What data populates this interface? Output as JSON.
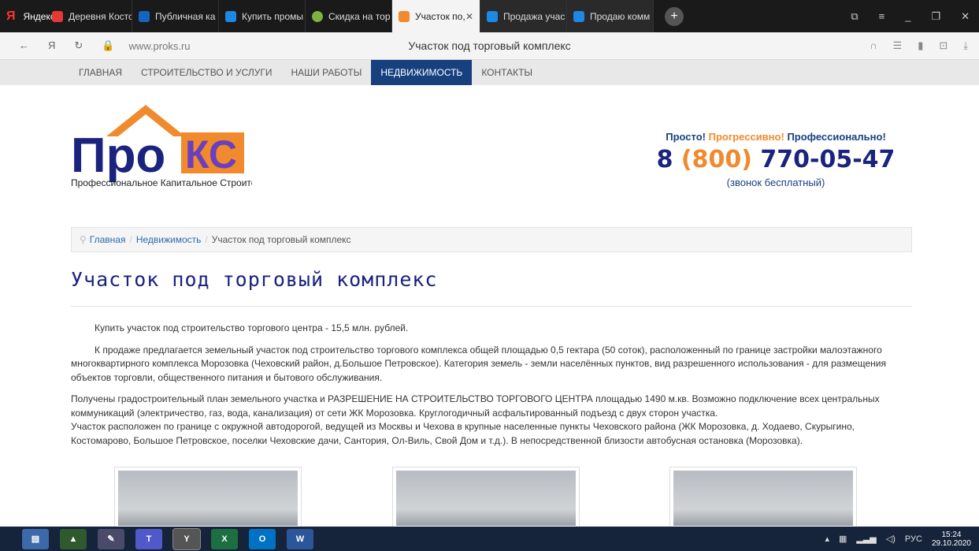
{
  "browser": {
    "yandex_label": "Яндекс",
    "tabs": [
      {
        "label": "Деревня Костс",
        "color": "#e53935"
      },
      {
        "label": "Публичная ка",
        "color": "#1565c0"
      },
      {
        "label": "Купить промы",
        "color": "#1e88e5"
      },
      {
        "label": "Скидка на тор",
        "color": "#7cb342"
      },
      {
        "label": "Участок по,",
        "color": "#f08a2c"
      },
      {
        "label": "Продажа учас",
        "color": "#1e88e5"
      },
      {
        "label": "Продаю комм",
        "color": "#1e88e5"
      }
    ],
    "url": "www.proks.ru",
    "page_title": "Участок под торговый комплекс"
  },
  "menu": [
    "ГЛАВНАЯ",
    "СТРОИТЕЛЬСТВО И УСЛУГИ",
    "НАШИ РАБОТЫ",
    "НЕДВИЖИМОСТЬ",
    "КОНТАКТЫ"
  ],
  "logo": {
    "word1": "Про",
    "word2": "КС",
    "sub": "Профессиональное Капитальное Строительство"
  },
  "contact": {
    "s1": "Просто!",
    "s2": "Прогрессивно!",
    "s3": "Профессионально!",
    "phone_a": "8 ",
    "phone_b": "(800)",
    "phone_c": " 770-05-47",
    "free": "(звонок бесплатный)"
  },
  "breadcrumb": {
    "home": "Главная",
    "sec": "Недвижимость",
    "cur": "Участок под торговый комплекс"
  },
  "heading": "Участок под торговый комплекс",
  "p1": "Купить участок под строительство торгового центра - 15,5 млн. рублей.",
  "p2": "К продаже предлагается земельный участок под строительство торгового комплекса общей площадью 0,5 гектара (50 соток), расположенный по границе застройки малоэтажного многоквартирного комплекса Морозовка (Чеховский район, д.Большое Петровское). Категория земель - земли населённых пунктов, вид разрешенного использования - для размещения объектов торговли, общественного питания и бытового обслуживания.",
  "p3": "Получены градостроительный план земельного участка и РАЗРЕШЕНИЕ НА СТРОИТЕЛЬСТВО ТОРГОВОГО ЦЕНТРА площадью 1490 м.кв. Возможно подключение всех центральных коммуникаций (электричество, газ, вода, канализация) от сети ЖК Морозовка. Круглогодичный асфальтированный подъезд с двух сторон участка.",
  "p4": "Участок расположен по границе с окружной автодорогой, ведущей из Москвы и Чехова в крупные населенные пункты Чеховского района (ЖК Морозовка, д. Ходаево, Скурыгино, Костомарово, Большое Петровское, поселки Чеховские дачи, Сантория, Ол-Виль, Свой Дом и т.д.). В непосредственной близости автобусная остановка (Морозовка).",
  "tray": {
    "lang": "РУС",
    "time": "15:24",
    "date": "29.10.2020"
  }
}
